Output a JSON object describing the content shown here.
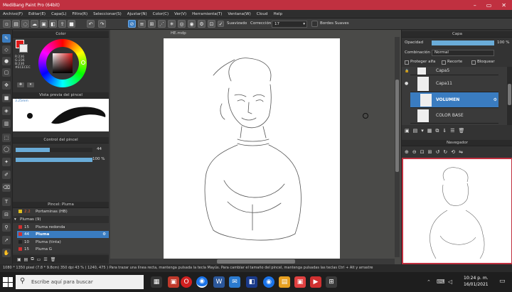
{
  "app": {
    "title": "MediBang Paint Pro (64bit)"
  },
  "menu": [
    "Archivo(F)",
    "Editar(E)",
    "Capa(L)",
    "Filtro(R)",
    "Seleccionar(S)",
    "Ajustar(N)",
    "Color(C)",
    "Ver(V)",
    "Herramienta(T)",
    "Ventana(W)",
    "Cloud",
    "Help"
  ],
  "toolbar": {
    "smooth_label": "Suavizado",
    "correction_label": "Corrección",
    "correction_value": "17",
    "soft_edges_label": "Bordes Suaves"
  },
  "color_panel": {
    "title": "Color",
    "r": "R:236",
    "g": "G:236",
    "b": "B:236",
    "hex": "#ECECEC"
  },
  "brush_preview": {
    "title": "Vista previa del pincel",
    "size": "3.25mm"
  },
  "brush_control": {
    "title": "Control del pincel",
    "size_value": "44",
    "opacity_value": "100 %",
    "size_fill": 0.44,
    "opacity_fill": 1.0
  },
  "brush_list": {
    "title": "Pincel: Pluma",
    "items": [
      {
        "size": "2.2",
        "name": "Portaminas (HB)",
        "color": "#e0c020"
      },
      {
        "size": "",
        "name": "Plumas (9)",
        "color": ""
      },
      {
        "size": "15",
        "name": "Pluma redonda",
        "color": "#d03030"
      },
      {
        "size": "44",
        "name": "Pluma",
        "color": "#d03030"
      },
      {
        "size": "10",
        "name": "Pluma (tinta)",
        "color": "#222222"
      },
      {
        "size": "15",
        "name": "Pluma G",
        "color": "#d03030"
      }
    ]
  },
  "document": {
    "tab": "HE.mdp"
  },
  "layer_panel": {
    "title": "Capa",
    "opacity_label": "Opacidad",
    "opacity_value": "100 %",
    "opacity_fill": 1.0,
    "blend_label": "Combinación",
    "blend_value": "Normal",
    "protect_alpha": "Proteger alfa",
    "clip": "Recorte",
    "lock": "Bloquear",
    "layers": [
      "Capa5",
      "Capa11",
      "VOLUMEN",
      "COLOR BASE"
    ]
  },
  "navigator": {
    "title": "Navegador"
  },
  "status": {
    "text": "1080 * 1350 pixel   (7.8 * 9.8cm)   350 dpi   43 %   ( 1240, 475 )   Para trazar una línea recta, mantenga pulsada la tecla Mayús. Para cambiar el tamaño del pincel, mantenga pulsadas las teclas Ctrl + Alt y arrastre"
  },
  "taskbar": {
    "search_placeholder": "Escribe aquí para buscar",
    "time": "10:24 p. m.",
    "date": "16/01/2021"
  },
  "colors": {
    "accent": "#3a7cc0",
    "titlebar": "#c03040"
  }
}
